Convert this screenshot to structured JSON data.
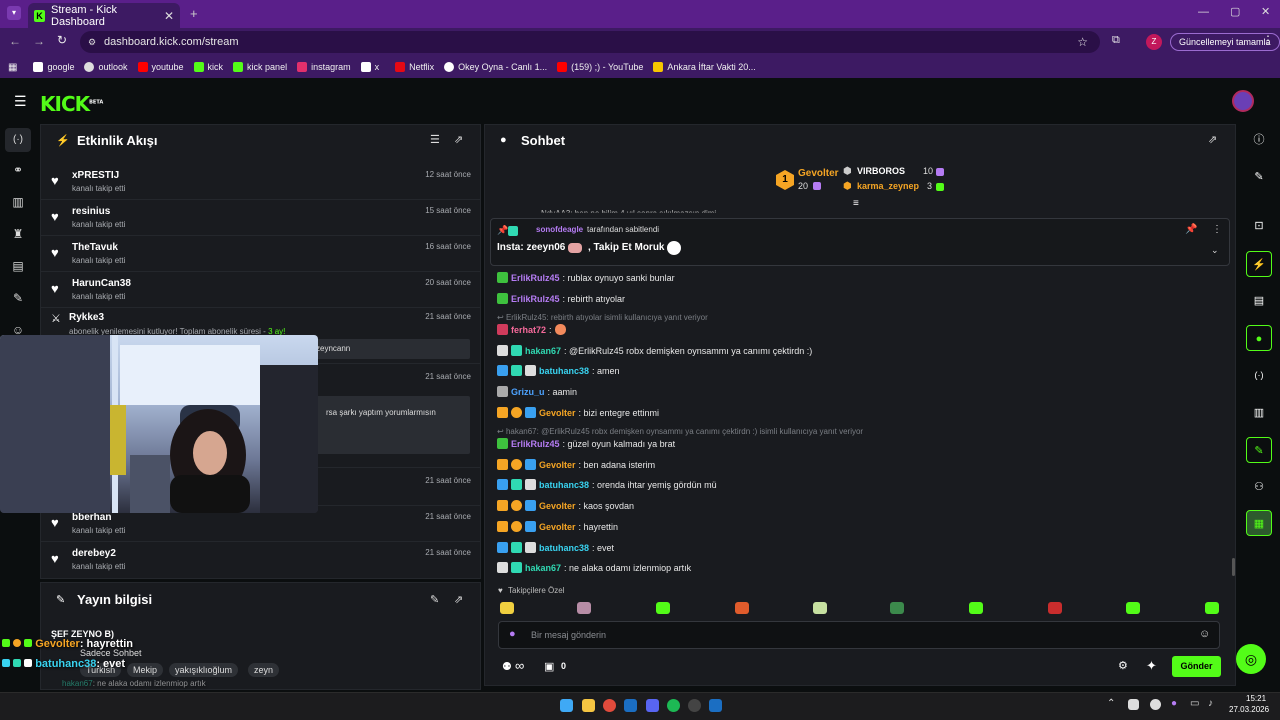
{
  "browser": {
    "tab_title": "Stream - Kick Dashboard",
    "url": "dashboard.kick.com/stream",
    "update_button": "Güncellemeyi tamamla",
    "profile_initial": "Z",
    "bookmarks": [
      "google",
      "outlook",
      "youtube",
      "kick",
      "kick panel",
      "instagram",
      "x",
      "Netflix",
      "Okey Oyna - Canlı 1...",
      "(159) ;) - YouTube",
      "Ankara İftar Vakti 20..."
    ]
  },
  "kick": {
    "logo": "KICK",
    "logo_beta": "BETA"
  },
  "activity": {
    "title": "Etkinlik Akışı",
    "events": [
      {
        "name": "xPRESTIJ",
        "sub": "kanalı takip etti",
        "time": "12 saat önce"
      },
      {
        "name": "resinius",
        "sub": "kanalı takip etti",
        "time": "15 saat önce"
      },
      {
        "name": "TheTavuk",
        "sub": "kanalı takip etti",
        "time": "16 saat önce"
      },
      {
        "name": "HarunCan38",
        "sub": "kanalı takip etti",
        "time": "20 saat önce"
      }
    ],
    "sub_event": {
      "name": "Rykke3",
      "sub_prefix": "abonelik yenilemesini kutluyor! Toplam abonelik süresi - ",
      "sub_months": "3 ay!",
      "time": "21 saat önce",
      "note": "zeyncann"
    },
    "event_time_2": "21 saat önce",
    "event_note_2": "rsa şarkı yaptım yorumlarmısın",
    "event_time_3": "21 saat önce",
    "bottom_events": [
      {
        "name": "bberhan",
        "sub": "kanalı takip etti",
        "time": "21 saat önce"
      },
      {
        "name": "derebey2",
        "sub": "kanalı takip etti",
        "time": "21 saat önce"
      }
    ]
  },
  "stream_info": {
    "title": "Yayın bilgisi",
    "stream_title": "ŞEF ZEYNO B)",
    "chat_mode": "Sadece Sohbet",
    "tags": [
      "Turkish",
      "Mekip",
      "yakışıklıoğlum",
      "zeyn"
    ]
  },
  "overlay_chat": [
    {
      "user": "Gevolter",
      "text": ": hayrettin"
    },
    {
      "user": "batuhanc38",
      "text": ": evet"
    },
    {
      "user": "hakan67",
      "text": ": ne alaka odamı izlenmiop artık"
    }
  ],
  "chat": {
    "title": "Sohbet",
    "leaderboard": [
      {
        "rank": "1",
        "name": "Gevolter",
        "score": "20"
      },
      {
        "name": "VIRBOROS",
        "score": "10"
      },
      {
        "name": "karma_zeynep",
        "score": "3"
      }
    ],
    "top_partial": "NdyAA3: ben ne bilim 4 yıl sonra sıkılmazsın dimi",
    "pinned_by": "sonofdeagle",
    "pinned_label": "tarafından sabitlendi",
    "pinned_text_1": "Insta: zeeyn06",
    "pinned_text_2": ", Takip Et Moruk",
    "messages": [
      {
        "user": "ErlikRulz45",
        "text": ": rublax oynuyo sanki bunlar",
        "color": "#b57cf3"
      },
      {
        "user": "ErlikRulz45",
        "text": ": rebirth atıyolar",
        "color": "#b57cf3"
      },
      {
        "reply": "ErlikRulz45: rebirth atıyolar isimli kullanıcıya yanıt veriyor"
      },
      {
        "user": "ferhat72",
        "text": ": ",
        "color": "#f56a9b"
      },
      {
        "user": "hakan67",
        "text": ": @ErlikRulz45 robx demişken oynsammı ya canımı çektirdn :)",
        "color": "#30d9b3"
      },
      {
        "user": "batuhanc38",
        "text": ": amen",
        "color": "#39d3f0"
      },
      {
        "user": "Grizu_u",
        "text": ": aamin",
        "color": "#4da3ff"
      },
      {
        "user": "Gevolter",
        "text": ": bizi entegre ettinmi",
        "color": "#f5a524"
      },
      {
        "reply": "hakan67: @ErlikRulz45 robx demişken oynsammı ya canımı çektirdn :) isimli kullanıcıya yanıt veriyor"
      },
      {
        "user": "ErlikRulz45",
        "text": ": güzel oyun kalmadı ya brat",
        "color": "#b57cf3"
      },
      {
        "user": "Gevolter",
        "text": ": ben adana isterim",
        "color": "#f5a524"
      },
      {
        "user": "batuhanc38",
        "text": ": orenda ihtar yemiş gördün mü",
        "color": "#39d3f0"
      },
      {
        "user": "Gevolter",
        "text": ": kaos şovdan",
        "color": "#f5a524"
      },
      {
        "user": "Gevolter",
        "text": ": hayrettin",
        "color": "#f5a524"
      },
      {
        "user": "batuhanc38",
        "text": ": evet",
        "color": "#39d3f0"
      },
      {
        "user": "hakan67",
        "text": ": ne alaka odamı izlenmiop artık",
        "color": "#30d9b3"
      }
    ],
    "followers_only": "Takipçilere Özel",
    "input_placeholder": "Bir mesaj gönderin",
    "infinity": "∞",
    "count": "0",
    "send": "Gönder"
  },
  "taskbar": {
    "time": "15:21",
    "date": "27.03.2026"
  }
}
